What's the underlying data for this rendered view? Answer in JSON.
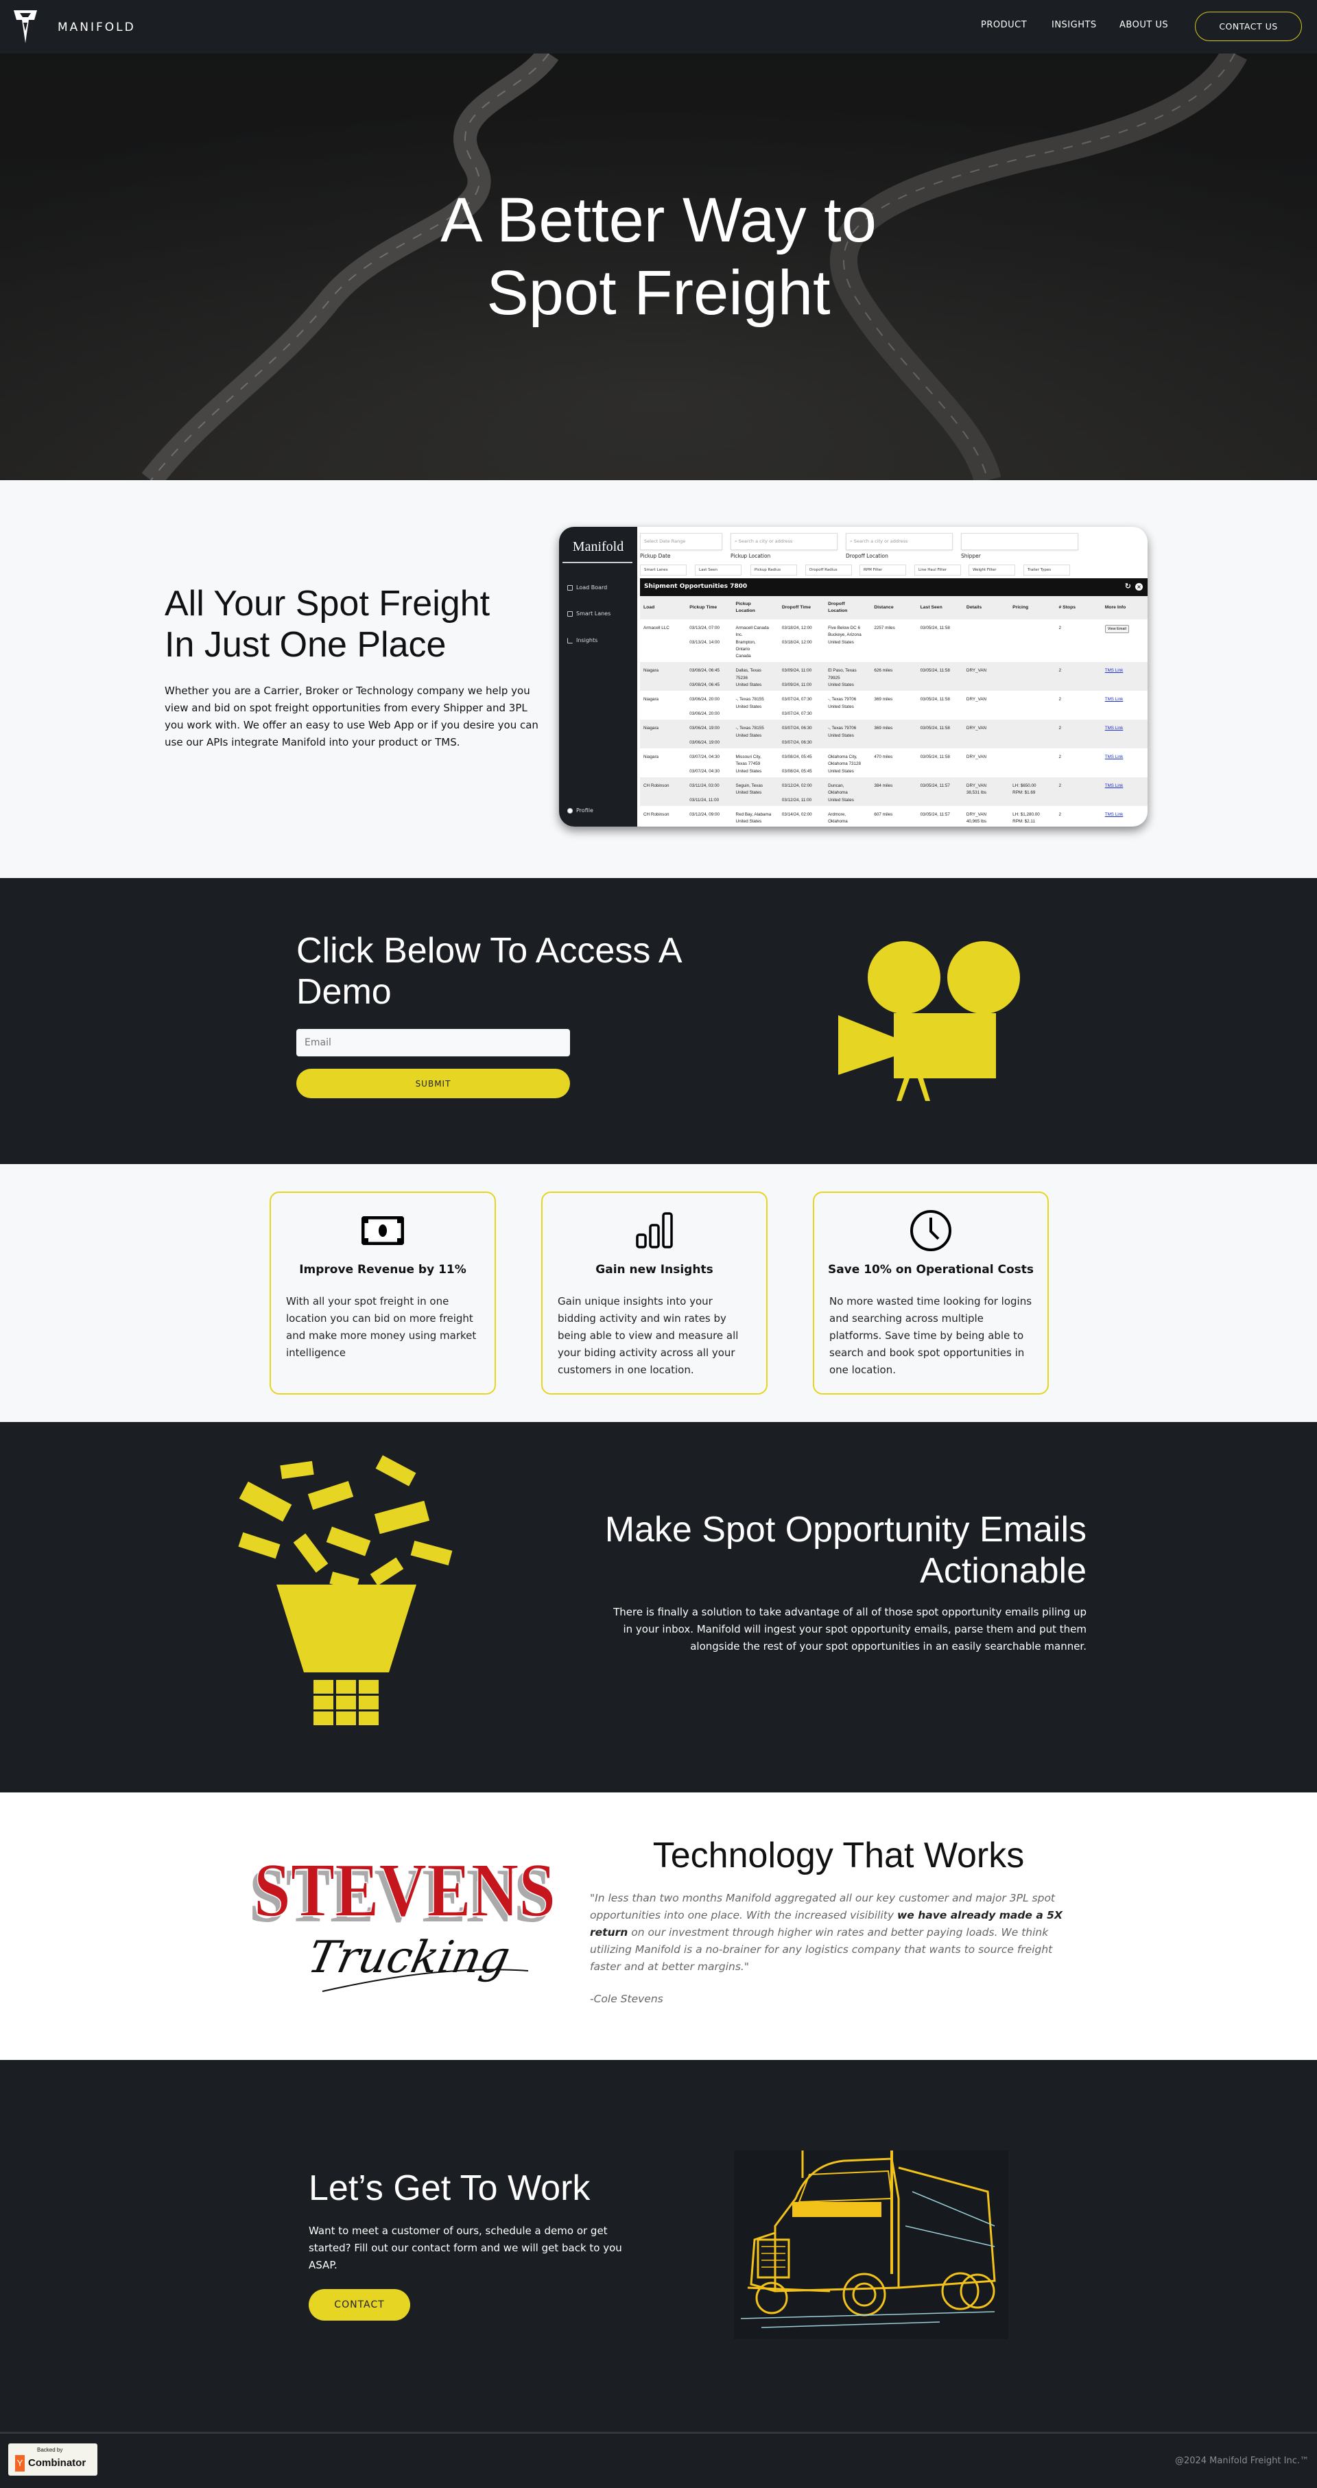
{
  "nav": {
    "brand": "MANIFOLD",
    "links": [
      "PRODUCT",
      "INSIGHTS",
      "ABOUT US"
    ],
    "contact_label": "CONTACT US"
  },
  "hero": {
    "title_line1": "A Better Way to",
    "title_line2": "Spot Freight"
  },
  "overview": {
    "title_line1": "All Your Spot Freight",
    "title_line2": "In Just One Place",
    "body": "Whether you are a Carrier, Broker or Technology company we help you view and bid on spot freight opportunities from every Shipper and 3PL you work with. We offer an easy to use Web App or if you desire you can use our APIs integrate Manifold into your product or TMS."
  },
  "app": {
    "logo": "Manifold",
    "sidebar": [
      "Load Board",
      "Smart Lanes",
      "Insights"
    ],
    "profile": "Profile",
    "filters": [
      {
        "placeholder": "Select Date Range",
        "label": "Pickup Date"
      },
      {
        "placeholder": "Search a city or address",
        "label": "Pickup Location"
      },
      {
        "placeholder": "Search a city or address",
        "label": "Dropoff Location"
      },
      {
        "placeholder": "",
        "label": "Shipper"
      }
    ],
    "chips": [
      "Smart Lanes",
      "Last Seen",
      "Pickup Radius",
      "Dropoff Radius",
      "RPM Filter",
      "Line Haul Filter",
      "Weight Filter",
      "Trailer Types"
    ],
    "table_title": "Shipment Opportunities 7800",
    "columns": [
      "Load",
      "Pickup Time",
      "Pickup\nLocation",
      "Dropoff Time",
      "Dropoff\nLocation",
      "Distance",
      "Last Seen",
      "Details",
      "Pricing",
      "# Stops",
      "More Info"
    ],
    "rows": [
      [
        "Armacell LLC",
        "03/13/24, 07:00\n\n03/13/24, 14:00",
        "Armacell Canada\nInc.\nBrampton,\nOntario\nCanada",
        "03/18/24, 12:00\n\n03/18/24, 12:00",
        "Five Below DC 6\nBuckeye, Arizona\nUnited States",
        "2257 miles",
        "03/05/24, 11:58",
        "",
        "",
        "2",
        "View Email"
      ],
      [
        "Niagara",
        "03/08/24, 06:45\n\n03/08/24, 06:45",
        "Dallas, Texas\n75236\nUnited States",
        "03/09/24, 11:00\n\n03/09/24, 11:00",
        "El Paso, Texas\n79925\nUnited States",
        "626 miles",
        "03/05/24, 11:58",
        "DRY_VAN",
        "",
        "2",
        "TMS Link"
      ],
      [
        "Niagara",
        "03/06/24, 20:00\n\n03/06/24, 20:00",
        "-, Texas 78155\nUnited States",
        "03/07/24, 07:30\n\n03/07/24, 07:30",
        "-, Texas 79706\nUnited States",
        "369 miles",
        "03/05/24, 11:58",
        "DRY_VAN",
        "",
        "2",
        "TMS Link"
      ],
      [
        "Niagara",
        "03/06/24, 19:00\n\n03/06/24, 19:00",
        "-, Texas 78155\nUnited States",
        "03/07/24, 06:30\n\n03/07/24, 06:30",
        "-, Texas 79706\nUnited States",
        "369 miles",
        "03/05/24, 11:58",
        "DRY_VAN",
        "",
        "2",
        "TMS Link"
      ],
      [
        "Niagara",
        "03/07/24, 04:30\n\n03/07/24, 04:30",
        "Missouri City,\nTexas 77459\nUnited States",
        "03/08/24, 05:45\n\n03/08/24, 05:45",
        "Oklahoma City,\nOklahoma 73128\nUnited States",
        "470 miles",
        "03/05/24, 11:58",
        "DRY_VAN",
        "",
        "2",
        "TMS Link"
      ],
      [
        "CH Robinson",
        "03/11/24, 03:00\n\n03/11/24, 11:00",
        "Seguin, Texas\nUnited States",
        "03/12/24, 02:00\n\n03/12/24, 11:00",
        "Duncan,\nOklahoma\nUnited States",
        "384 miles",
        "03/05/24, 11:57",
        "DRY_VAN\n38,531 lbs",
        "LH: $650.00\nRPM: $1.69",
        "2",
        "TMS Link"
      ],
      [
        "CH Robinson",
        "03/12/24, 09:00\n\n03/12/24, 09:00",
        "Red Bay, Alabama\nUnited States",
        "03/14/24, 02:00\n\n03/14/24, 02:00",
        "Ardmore,\nOklahoma\nUnited States",
        "607 miles",
        "03/05/24, 11:57",
        "DRY_VAN\n40,965 lbs",
        "LH: $1,280.00\nRPM: $2.11",
        "2",
        "TMS Link"
      ]
    ]
  },
  "demo": {
    "title": "Click Below To Access A Demo",
    "email_placeholder": "Email",
    "submit_label": "SUBMIT"
  },
  "features": [
    {
      "icon": "money-bill-icon",
      "title": "Improve Revenue by 11%",
      "body": "With all your spot freight in one location you can bid on more freight and make more money using market intelligence"
    },
    {
      "icon": "bar-chart-icon",
      "title": "Gain new Insights",
      "body": "Gain unique insights into your bidding activity and win rates by being able to view and measure all your biding activity across all your customers in one location."
    },
    {
      "icon": "clock-icon",
      "title": "Save 10% on Operational Costs",
      "body": "No more wasted time looking for logins and searching across multiple platforms. Save time by being able to search and book spot opportunities in one location."
    }
  ],
  "emails": {
    "title_line1": "Make Spot Opportunity Emails",
    "title_line2": "Actionable",
    "body": "There is finally a solution to take advantage of all of those spot opportunity emails piling up in your inbox. Manifold will ingest your spot opportunity emails, parse them and put them alongside the rest of your spot opportunities in an easily searchable manner."
  },
  "testimonial": {
    "logo_text": "STEVENS",
    "logo_script": "Trucking",
    "title": "Technology That Works",
    "quote_before": "\"In less than two months Manifold aggregated all our key customer and major 3PL spot opportunities into one place. With the increased visibility ",
    "quote_bold": "we have already made a 5X return",
    "quote_after": " on our investment through higher win rates and better paying loads. We think utilizing Manifold is a no-brainer for any logistics company that wants to source freight faster and at better margins.\"",
    "author": "-Cole Stevens"
  },
  "cta": {
    "title": "Let’s Get To Work",
    "body": "Want to meet a customer of ours, schedule a demo or get started? Fill out our contact form and we will get back to you ASAP.",
    "button": "CONTACT"
  },
  "footer": {
    "badge_top": "Backed by",
    "badge_y": "Y",
    "badge_name": "Combinator",
    "copyright": "@2024 Manifold Freight Inc.™"
  },
  "colors": {
    "accent": "#e6d523",
    "dark": "#1b1e23",
    "light": "#f6f8fa",
    "link": "#1a2fd6",
    "logo_red": "#c4161c"
  }
}
